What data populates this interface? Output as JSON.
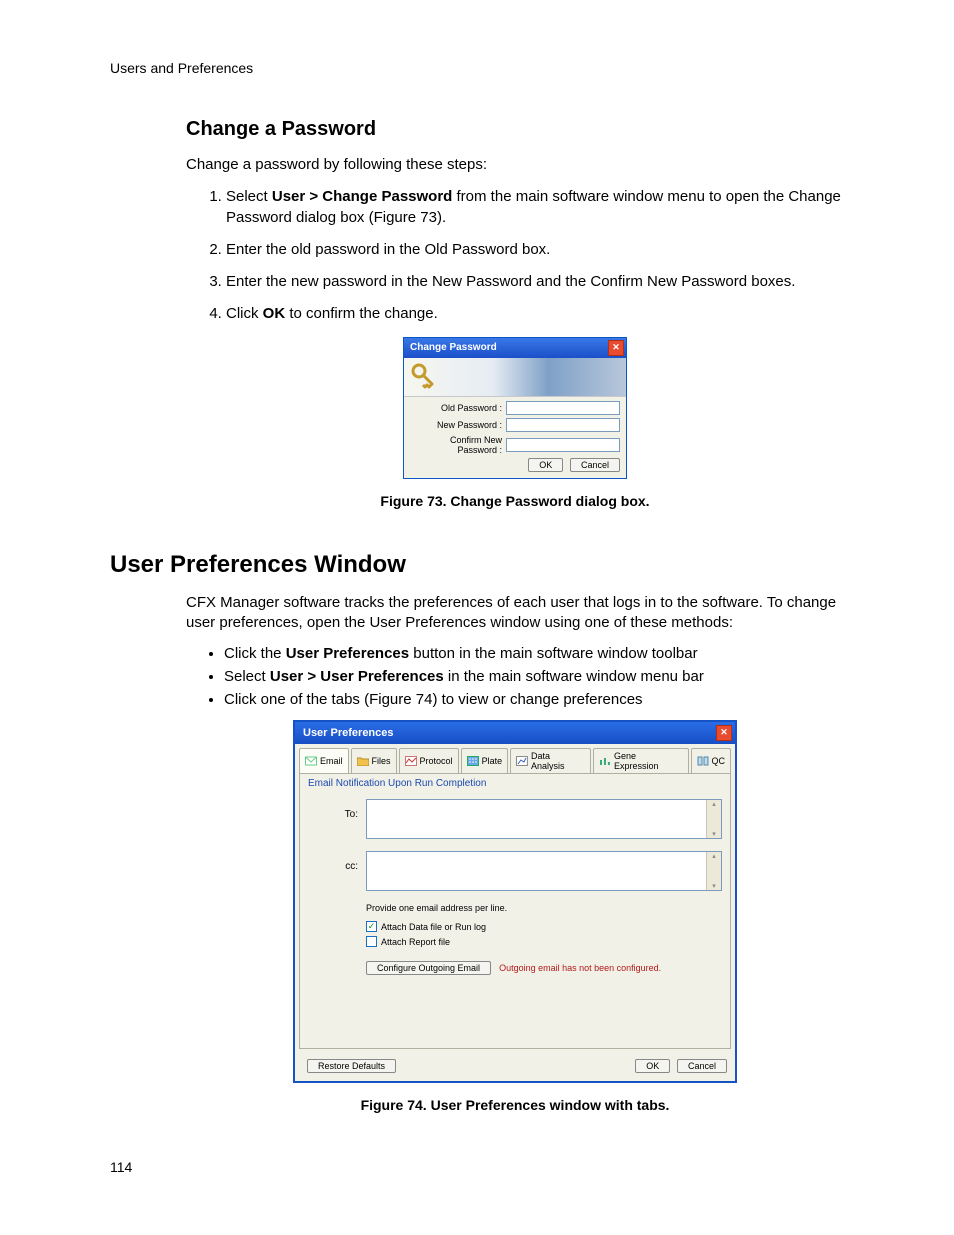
{
  "running_head": "Users and Preferences",
  "page_number": "114",
  "section1": {
    "heading": "Change a Password",
    "intro": "Change a password by following these steps:",
    "steps": [
      {
        "pre": "Select ",
        "bold": "User > Change Password",
        "post": " from the main software window menu to open the Change Password dialog box (Figure 73)."
      },
      {
        "text": "Enter the old password in the Old Password box."
      },
      {
        "text": "Enter the new password in the New Password and the Confirm New Password boxes."
      },
      {
        "pre": "Click ",
        "bold": "OK",
        "post": " to confirm the change."
      }
    ],
    "caption": "Figure 73. Change Password dialog box."
  },
  "cp_dialog": {
    "title": "Change Password",
    "labels": {
      "old": "Old Password :",
      "new": "New Password :",
      "confirm": "Confirm New Password :"
    },
    "buttons": {
      "ok": "OK",
      "cancel": "Cancel"
    }
  },
  "section2": {
    "heading": "User Preferences Window",
    "intro": "CFX Manager software tracks the preferences of each user that logs in to the software. To change user preferences, open the User Preferences window using one of these methods:",
    "bullets": [
      {
        "pre": "Click the ",
        "bold": "User Preferences",
        "post": " button in the main software window toolbar"
      },
      {
        "pre": "Select ",
        "bold": "User > User Preferences",
        "post": " in the main software window menu bar"
      },
      {
        "text": "Click one of the tabs (Figure 74) to view or change preferences"
      }
    ],
    "caption": "Figure 74. User Preferences window with tabs."
  },
  "up_window": {
    "title": "User Preferences",
    "tabs": [
      "Email",
      "Files",
      "Protocol",
      "Plate",
      "Data Analysis",
      "Gene Expression",
      "QC"
    ],
    "pane_title": "Email Notification Upon Run Completion",
    "to_label": "To:",
    "cc_label": "cc:",
    "note": "Provide one email address per line.",
    "check1": "Attach Data file or Run log",
    "check2": "Attach Report file",
    "cfg_btn": "Configure Outgoing Email",
    "cfg_warn": "Outgoing email has not been configured.",
    "restore": "Restore Defaults",
    "ok": "OK",
    "cancel": "Cancel"
  }
}
